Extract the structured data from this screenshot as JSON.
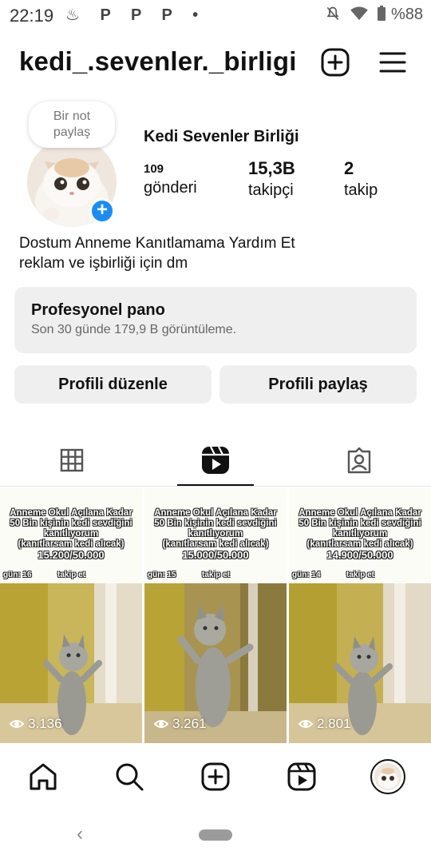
{
  "status_bar": {
    "time": "22:19",
    "notification_icons": "♨ P P P •",
    "battery": "%88"
  },
  "header": {
    "username": "kedi_.sevenler._birligi"
  },
  "profile": {
    "note_text_line1": "Bir not",
    "note_text_line2": "paylaş",
    "display_name": "Kedi Sevenler Birliği",
    "stats": {
      "posts_count": "109",
      "posts_label": "gönderi",
      "followers_count": "15,3B",
      "followers_label": "takipçi",
      "following_count": "2",
      "following_label": "takip"
    },
    "bio_line1": "Dostum Anneme Kanıtlamama Yardım Et",
    "bio_line2": "reklam ve işbirliği için dm"
  },
  "dashboard": {
    "title": "Profesyonel pano",
    "subtitle": "Son 30 günde 179,9 B görüntüleme."
  },
  "buttons": {
    "edit_profile": "Profili düzenle",
    "share_profile": "Profili paylaş"
  },
  "grid": {
    "posts": [
      {
        "caption_l1": "Anneme Okul Açılana Kadar",
        "caption_l2": "50 Bin kişinin kedi sevdiğini",
        "caption_l3": "kanıtlıyorum",
        "caption_l4": "(kanıtlarsam kedi alıcak)",
        "progress": "15.200/50.000",
        "day": "gün: 16",
        "follow": "takip et",
        "views": "3.136"
      },
      {
        "caption_l1": "Anneme Okul Açılana Kadar",
        "caption_l2": "50 Bin kişinin kedi sevdiğini",
        "caption_l3": "kanıtlıyorum",
        "caption_l4": "(kanıtlarsam kedi alıcak)",
        "progress": "15.000/50.000",
        "day": "gün: 15",
        "follow": "takip et",
        "views": "3.261"
      },
      {
        "caption_l1": "Anneme Okul Açılana Kadar",
        "caption_l2": "50 Bin kişinin kedi sevdiğini",
        "caption_l3": "kanıtlıyorum",
        "caption_l4": "(kanıtlarsam kedi alıcak)",
        "progress": "14.900/50.000",
        "day": "gün: 14",
        "follow": "takip et",
        "views": "2.801"
      }
    ]
  },
  "colors": {
    "accent_blue": "#1a8cf4",
    "button_bg": "#efefef",
    "text": "#111111"
  },
  "icons": {
    "header": [
      "plus-square-icon",
      "hamburger-menu-icon"
    ],
    "tabs": [
      "grid-icon",
      "reels-icon",
      "tagged-icon"
    ],
    "nav": [
      "home-icon",
      "search-icon",
      "create-icon",
      "reels-icon",
      "profile-avatar"
    ]
  }
}
